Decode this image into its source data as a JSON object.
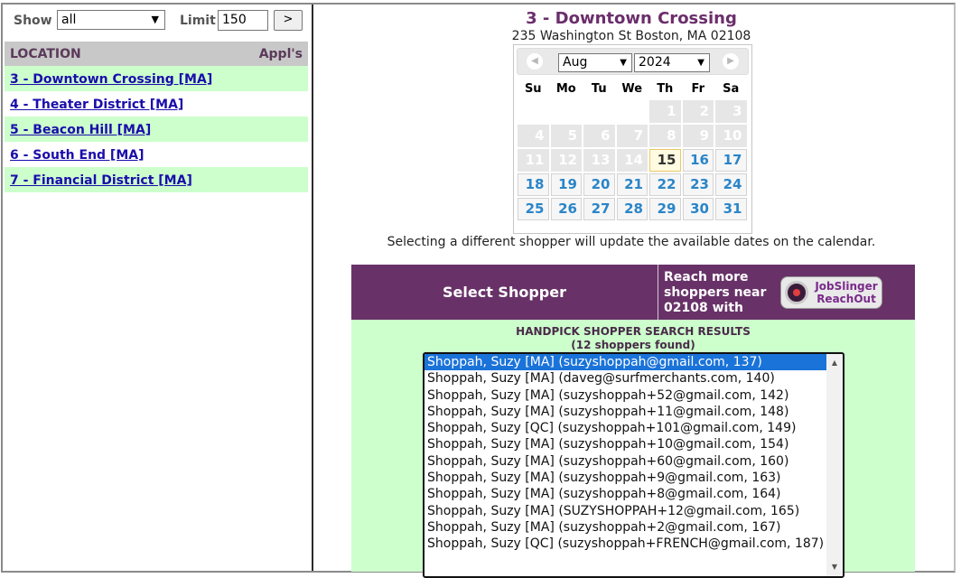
{
  "filter": {
    "show_label": "Show",
    "show_value": "all",
    "limit_label": "Limit",
    "limit_value": "150",
    "go_label": ">"
  },
  "locations": {
    "header_location": "LOCATION",
    "header_appls": "Appl's",
    "items": [
      {
        "label": "3 - Downtown Crossing [MA]"
      },
      {
        "label": "4 - Theater District [MA]"
      },
      {
        "label": "5 - Beacon Hill [MA]"
      },
      {
        "label": "6 - South End [MA]"
      },
      {
        "label": "7 - Financial District [MA]"
      }
    ]
  },
  "store": {
    "title": "3 - Downtown Crossing",
    "address": "235 Washington St Boston, MA  02108"
  },
  "calendar": {
    "month": "Aug",
    "year": "2024",
    "dow": [
      "Su",
      "Mo",
      "Tu",
      "We",
      "Th",
      "Fr",
      "Sa"
    ],
    "today": "15",
    "weeks": [
      [
        "",
        "",
        "",
        "",
        "1",
        "2",
        "3"
      ],
      [
        "4",
        "5",
        "6",
        "7",
        "8",
        "9",
        "10"
      ],
      [
        "11",
        "12",
        "13",
        "14",
        "15",
        "16",
        "17"
      ],
      [
        "18",
        "19",
        "20",
        "21",
        "22",
        "23",
        "24"
      ],
      [
        "25",
        "26",
        "27",
        "28",
        "29",
        "30",
        "31"
      ]
    ],
    "note": "Selecting a different shopper will update the available dates on the calendar."
  },
  "shopper_panel": {
    "title": "Select Shopper",
    "reach_text": "Reach more shoppers near 02108 with",
    "logo_line1": "JobSlinger",
    "logo_line2": "ReachOut",
    "results_title": "HANDPICK SHOPPER SEARCH RESULTS",
    "results_count": "(12 shoppers found)",
    "options": [
      "Shoppah, Suzy [MA] (suzyshoppah@gmail.com, 137)",
      "Shoppah, Suzy [MA] (daveg@surfmerchants.com, 140)",
      "Shoppah, Suzy [MA] (suzyshoppah+52@gmail.com, 142)",
      "Shoppah, Suzy [MA] (suzyshoppah+11@gmail.com, 148)",
      "Shoppah, Suzy [QC] (suzyshoppah+101@gmail.com, 149)",
      "Shoppah, Suzy [MA] (suzyshoppah+10@gmail.com, 154)",
      "Shoppah, Suzy [MA] (suzyshoppah+60@gmail.com, 160)",
      "Shoppah, Suzy [MA] (suzyshoppah+9@gmail.com, 163)",
      "Shoppah, Suzy [MA] (suzyshoppah+8@gmail.com, 164)",
      "Shoppah, Suzy [MA] (SUZYSHOPPAH+12@gmail.com, 165)",
      "Shoppah, Suzy [MA] (suzyshoppah+2@gmail.com, 167)",
      "Shoppah, Suzy [QC] (suzyshoppah+FRENCH@gmail.com, 187)"
    ]
  },
  "colors": {
    "brand_purple": "#683268",
    "row_green": "#ccffcc",
    "link_blue": "#1a0dab",
    "selected_blue": "#1a73d9"
  }
}
